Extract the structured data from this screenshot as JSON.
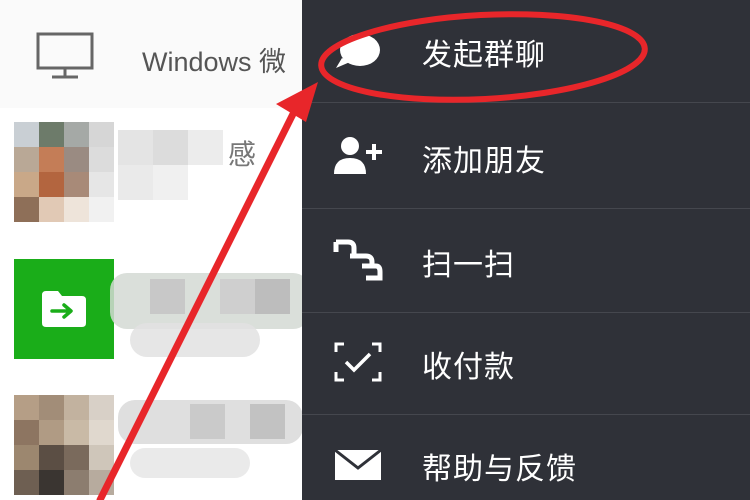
{
  "chat_list": {
    "windows_row_label": "Windows 微",
    "row1_partial_text": "感"
  },
  "menu": {
    "items": [
      {
        "label": "发起群聊",
        "icon": "chat-bubble-icon"
      },
      {
        "label": "添加朋友",
        "icon": "add-friend-icon"
      },
      {
        "label": "扫一扫",
        "icon": "scan-icon"
      },
      {
        "label": "收付款",
        "icon": "payment-scan-icon"
      },
      {
        "label": "帮助与反馈",
        "icon": "envelope-icon"
      }
    ]
  },
  "colors": {
    "menu_bg": "#2f3138",
    "annotation_red": "#e8262a",
    "file_green": "#1aad19"
  }
}
